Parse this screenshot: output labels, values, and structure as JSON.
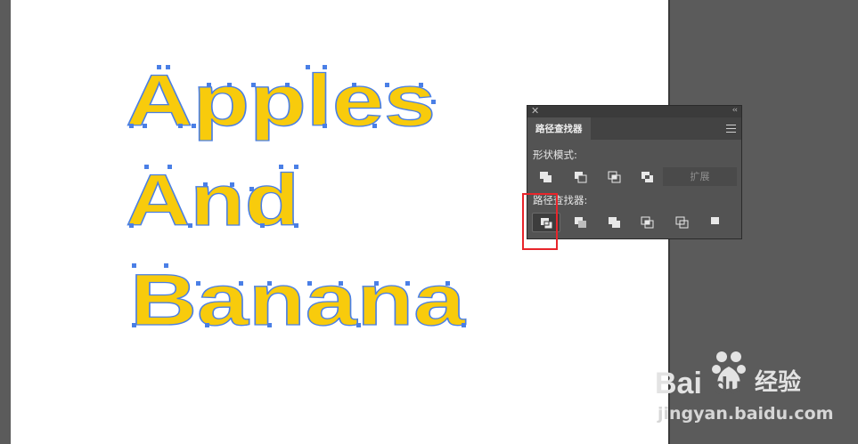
{
  "artwork": {
    "lines": [
      "Apples",
      "And",
      "Banana"
    ],
    "fill_color": "#f8cb0c",
    "selection_color": "#4a7fe6"
  },
  "panel": {
    "tab_title": "路径查找器",
    "shape_modes_label": "形状模式:",
    "pathfinders_label": "路径查找器:",
    "expand_label": "扩展",
    "shape_mode_buttons": [
      "unite-icon",
      "minus-front-icon",
      "intersect-icon",
      "exclude-icon"
    ],
    "pathfinder_buttons": [
      "divide-icon",
      "trim-icon",
      "merge-icon",
      "crop-icon",
      "outline-icon",
      "minus-back-icon"
    ]
  },
  "watermark": {
    "url": "jingyan.baidu.com"
  }
}
